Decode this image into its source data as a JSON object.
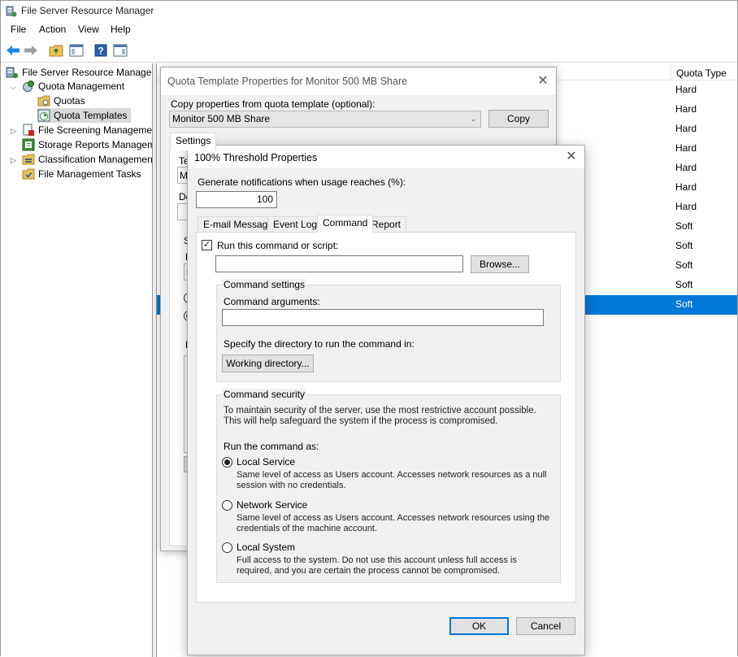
{
  "window": {
    "title": "File Server Resource Manager"
  },
  "menu": [
    "File",
    "Action",
    "View",
    "Help"
  ],
  "tree": {
    "root": "File Server Resource Manager (Local)",
    "quota_management": "Quota Management",
    "quotas": "Quotas",
    "quota_templates": "Quota Templates",
    "file_screening": "File Screening Management",
    "storage_reports": "Storage Reports Management",
    "classification": "Classification Management",
    "file_tasks": "File Management Tasks"
  },
  "list": {
    "column_quota_type": "Quota Type",
    "rows": [
      "Hard",
      "Hard",
      "Hard",
      "Hard",
      "Hard",
      "Hard",
      "Hard",
      "Soft",
      "Soft",
      "Soft",
      "Soft",
      "Soft"
    ],
    "selected_index": 11
  },
  "qt_dialog": {
    "title": "Quota Template Properties for Monitor 500 MB Share",
    "copy_label": "Copy properties from quota template (optional):",
    "copy_value": "Monitor 500 MB Share",
    "copy_button": "Copy",
    "tab_settings": "Settings",
    "peek_te": "Te",
    "peek_m": "M",
    "peek_de": "De",
    "peek_s": "S",
    "peek_l": "L",
    "peek_5": "5",
    "peek_n": "N"
  },
  "th_dialog": {
    "title": "100% Threshold Properties",
    "gen_label": "Generate notifications when usage reaches (%):",
    "gen_value": "100",
    "tabs": [
      "E-mail Message",
      "Event Log",
      "Command",
      "Report"
    ],
    "active_tab": "Command",
    "run_cmd_label": "Run this command or script:",
    "run_cmd_checked": true,
    "cmd_value": "",
    "browse": "Browse...",
    "cmd_settings_title": "Command settings",
    "cmd_args_label": "Command arguments:",
    "cmd_args_value": "",
    "dir_label": "Specify the directory to run the command in:",
    "working_dir": "Working directory...",
    "security_title": "Command security",
    "security_desc": "To maintain security of the server, use the most restrictive account possible. This will help safeguard the system if the process is compromised.",
    "run_as_label": "Run the command as:",
    "options": [
      {
        "label": "Local Service",
        "desc": "Same level of access as Users account. Accesses network resources as a null session with no credentials.",
        "checked": true
      },
      {
        "label": "Network Service",
        "desc": "Same level of access as Users account. Accesses network resources using the credentials of the machine account.",
        "checked": false
      },
      {
        "label": "Local System",
        "desc": "Full access to the system. Do not use this account unless full access is required, and you are certain the process cannot be compromised.",
        "checked": false
      }
    ],
    "ok": "OK",
    "cancel": "Cancel"
  },
  "colors": {
    "accent": "#0078d7",
    "dialog_bg": "#f0f0f0"
  }
}
